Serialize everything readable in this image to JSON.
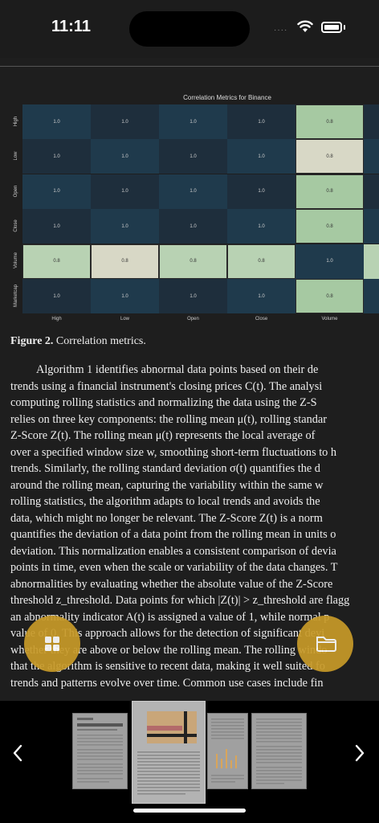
{
  "status": {
    "time": "11:11",
    "signal": "····"
  },
  "chart_data": {
    "type": "heatmap",
    "title": "Correlation Metrics for Binance",
    "rows": [
      "High",
      "Low",
      "Open",
      "Close",
      "Volume",
      "Marketcap"
    ],
    "columns": [
      "High",
      "Low",
      "Open",
      "Close",
      "Volume"
    ],
    "values": [
      [
        "1.0",
        "1.0",
        "1.0",
        "1.0",
        "0.8"
      ],
      [
        "1.0",
        "1.0",
        "1.0",
        "1.0",
        "0.8"
      ],
      [
        "1.0",
        "1.0",
        "1.0",
        "1.0",
        "0.8"
      ],
      [
        "1.0",
        "1.0",
        "1.0",
        "1.0",
        "0.8"
      ],
      [
        "0.8",
        "0.8",
        "0.8",
        "0.8",
        "1.0"
      ],
      [
        "1.0",
        "1.0",
        "1.0",
        "1.0",
        "0.8"
      ]
    ],
    "colors": {
      "dark": "#1f3a4c",
      "darker": "#1e2e3c",
      "light": "#d8d8c6",
      "mid": "#b8d2b3",
      "green": "#a6c9a2"
    }
  },
  "document": {
    "caption_label": "Figure 2.",
    "caption_text": " Correlation metrics.",
    "lines": [
      "Algorithm 1 identifies abnormal data points based on their de",
      "trends using a financial instrument's closing prices C(t). The analysi",
      "computing rolling statistics and normalizing the data using the Z-S",
      "relies on three key components: the rolling mean μ(t), rolling standar",
      "Z-Score Z(t). The rolling mean μ(t) represents the local average of",
      "over a specified window size w, smoothing short-term fluctuations to h",
      "trends. Similarly, the rolling standard deviation σ(t) quantifies the d",
      "around the rolling mean, capturing the variability within the same w",
      "rolling statistics, the algorithm adapts to local trends and avoids the",
      "data, which might no longer be relevant. The Z-Score Z(t) is a norm",
      "quantifies the deviation of a data point from the rolling mean in units o",
      "deviation. This normalization enables a consistent comparison of devia",
      "points in time, even when the scale or variability of the data changes. T",
      "abnormalities by evaluating whether the absolute value of the Z-Score",
      "threshold z_threshold. Data points for which |Z(t)| > z_threshold are flagg",
      "an abnormality indicator A(t) is assigned a value of 1, while normal p",
      "value of 0. This approach allows for the detection of significant devi",
      "whether they are above or below the rolling mean. The rolling windo",
      "that the algorithm is sensitive to recent data, making it well suited fo",
      "trends and patterns evolve over time. Common use cases include fin"
    ]
  },
  "colors": {
    "accent": "#c89a28",
    "link": "#e07a3f"
  }
}
